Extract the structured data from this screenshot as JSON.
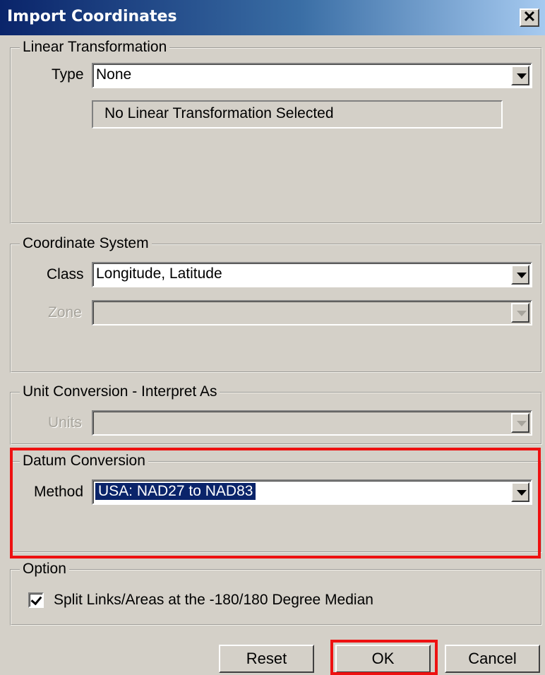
{
  "window": {
    "title": "Import Coordinates",
    "close_glyph": "✕"
  },
  "linear_transformation": {
    "legend": "Linear Transformation",
    "type_label": "Type",
    "type_value": "None",
    "info_text": "No Linear Transformation Selected"
  },
  "coordinate_system": {
    "legend": "Coordinate System",
    "class_label": "Class",
    "class_value": "Longitude, Latitude",
    "zone_label": "Zone",
    "zone_value": ""
  },
  "unit_conversion": {
    "legend": "Unit Conversion - Interpret As",
    "units_label": "Units",
    "units_value": ""
  },
  "datum_conversion": {
    "legend": "Datum Conversion",
    "method_label": "Method",
    "method_value": "USA: NAD27 to NAD83"
  },
  "option": {
    "legend": "Option",
    "split_label": "Split Links/Areas at the -180/180 Degree Median",
    "split_checked": true
  },
  "buttons": {
    "reset": "Reset",
    "ok": "OK",
    "cancel": "Cancel"
  },
  "colors": {
    "titlebar_start": "#0a246a",
    "highlight": "#ee1111",
    "face": "#d4d0c8"
  }
}
